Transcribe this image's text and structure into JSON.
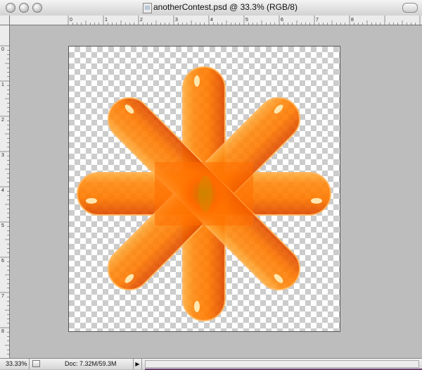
{
  "window": {
    "title": "anotherContest.psd @ 33.3% (RGB/8)"
  },
  "rulers": {
    "horizontal_labels": [
      "0",
      "1",
      "2",
      "3",
      "4",
      "5",
      "6",
      "7",
      "8"
    ],
    "vertical_labels": [
      "0",
      "1",
      "2",
      "3",
      "4",
      "5",
      "6",
      "7",
      "8"
    ]
  },
  "status": {
    "zoom": "33.33%",
    "doc_size": "Doc: 7.32M/59.3M",
    "arrow": "▶"
  },
  "icons": {
    "close": "close-icon",
    "minimize": "minimize-icon",
    "maximize": "maximize-icon",
    "document": "document-icon",
    "toolbar_toggle": "toolbar-toggle-icon",
    "status_preview": "status-preview-icon",
    "status_menu": "triangle-right-icon"
  },
  "colors": {
    "orange_main": "#ff7a00",
    "orange_light": "#ffb040",
    "orange_dark": "#e04a00",
    "canvas_bg": "#bdbdbd"
  }
}
